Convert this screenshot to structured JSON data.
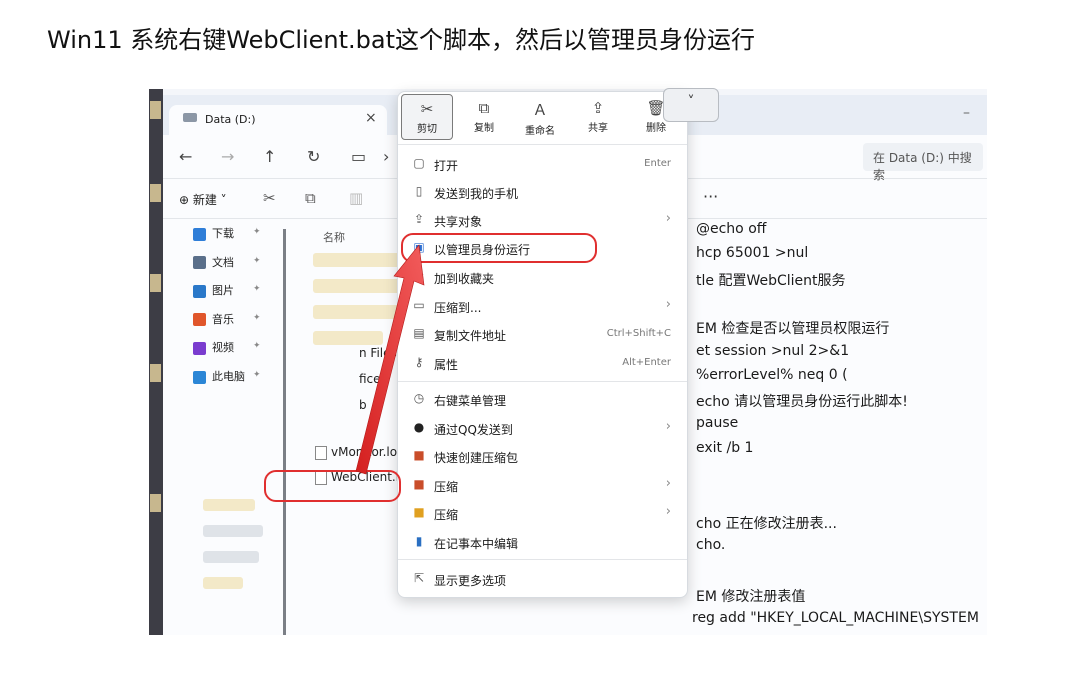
{
  "caption": "Win11 系统右键WebClient.bat这个脚本，然后以管理员身份运行",
  "explorer": {
    "tab_title": "Data (D:)",
    "tab_close": "×",
    "minimize": "–",
    "nav": {
      "back": "←",
      "forward": "→",
      "up": "↑",
      "refresh": "↻",
      "monitor": "▭",
      "chev": "›"
    },
    "search_placeholder": "在 Data (D:) 中搜索",
    "new_label": "⊕ 新建 ˅",
    "more": "···",
    "sidebar": [
      {
        "label": "下载",
        "icon_name": "download-icon",
        "color": "#2f7ed8"
      },
      {
        "label": "文档",
        "icon_name": "document-icon",
        "color": "#5a6f8a"
      },
      {
        "label": "图片",
        "icon_name": "picture-icon",
        "color": "#2a78c9"
      },
      {
        "label": "音乐",
        "icon_name": "music-icon",
        "color": "#e0562b"
      },
      {
        "label": "视频",
        "icon_name": "video-icon",
        "color": "#7a3ccf"
      },
      {
        "label": "此电脑",
        "icon_name": "computer-icon",
        "color": "#2b86d6"
      }
    ],
    "column_name": "名称",
    "files": [
      {
        "label": "n Files"
      },
      {
        "label": "fice"
      },
      {
        "label": "b"
      },
      {
        "label": "vMonitor.log"
      },
      {
        "label": "WebClient.bat"
      }
    ]
  },
  "context_menu": {
    "top_actions": [
      {
        "label": "剪切",
        "glyph": "✂",
        "icon_name": "cut-icon"
      },
      {
        "label": "复制",
        "glyph": "⧉",
        "icon_name": "copy-icon"
      },
      {
        "label": "重命名",
        "glyph": "Ａ",
        "icon_name": "rename-icon"
      },
      {
        "label": "共享",
        "glyph": "⇪",
        "icon_name": "share-icon"
      },
      {
        "label": "删除",
        "glyph": "🗑",
        "icon_name": "delete-icon"
      }
    ],
    "expand_glyph": "˅",
    "items": [
      {
        "label": "打开",
        "shortcut": "Enter",
        "glyph": "▢",
        "icon_name": "open-icon"
      },
      {
        "label": "发送到我的手机",
        "glyph": "▯",
        "icon_name": "phone-icon"
      },
      {
        "label": "共享对象",
        "glyph": "⇪",
        "icon_name": "share-with-icon",
        "arrow": "›"
      },
      {
        "label": "以管理员身份运行",
        "glyph": "▣",
        "icon_name": "admin-shield-icon"
      },
      {
        "label": "加到收藏夹",
        "glyph": "☆",
        "icon_name": "star-icon"
      },
      {
        "label": "压缩到...",
        "glyph": "▭",
        "icon_name": "compress-icon",
        "arrow": "›"
      },
      {
        "label": "复制文件地址",
        "shortcut": "Ctrl+Shift+C",
        "glyph": "▤",
        "icon_name": "copy-path-icon"
      },
      {
        "label": "属性",
        "shortcut": "Alt+Enter",
        "glyph": "⚷",
        "icon_name": "properties-icon"
      },
      {
        "label": "右键菜单管理",
        "glyph": "◷",
        "icon_name": "menu-manager-icon"
      },
      {
        "label": "通过QQ发送到",
        "glyph": "●",
        "icon_name": "qq-icon",
        "arrow": "›"
      },
      {
        "label": "快速创建压缩包",
        "glyph": "■",
        "icon_name": "archive-icon"
      },
      {
        "label": "压缩",
        "glyph": "■",
        "icon_name": "zip-icon",
        "arrow": "›"
      },
      {
        "label": "压缩",
        "glyph": "■",
        "icon_name": "zip-color-icon",
        "arrow": "›"
      },
      {
        "label": "在记事本中编辑",
        "glyph": "▮",
        "icon_name": "notepad-icon"
      },
      {
        "label": "显示更多选项",
        "glyph": "⇱",
        "icon_name": "more-options-icon"
      }
    ]
  },
  "code_lines": [
    "@echo off",
    "hcp 65001 >nul",
    "tle 配置WebClient服务",
    "",
    "EM 检查是否以管理员权限运行",
    "et session >nul 2>&1",
    " %errorLevel% neq 0 (",
    " echo 请以管理员身份运行此脚本!",
    " pause",
    " exit /b 1",
    "",
    "",
    "cho 正在修改注册表...",
    "cho.",
    "",
    "EM 修改注册表值",
    "reg add \"HKEY_LOCAL_MACHINE\\SYSTEM"
  ],
  "colors": {
    "highlight": "#e02f2f",
    "accent": "#2f7ed8"
  }
}
